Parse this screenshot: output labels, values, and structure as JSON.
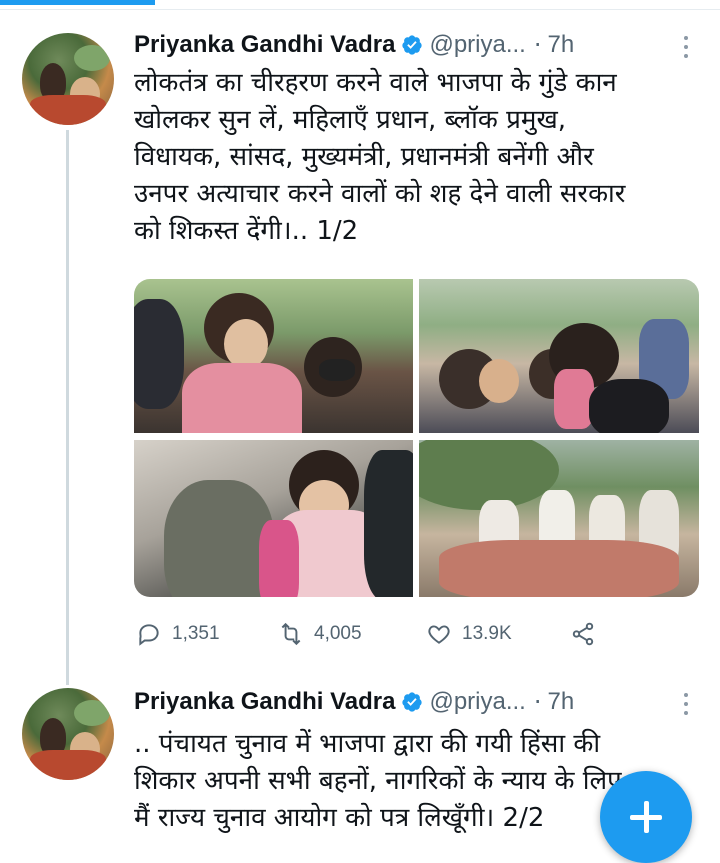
{
  "colors": {
    "accent": "#1d9bf0",
    "text": "#0f1419",
    "muted": "#536471"
  },
  "tweets": [
    {
      "author_name": "Priyanka Gandhi Vadra",
      "handle": "@priya...",
      "separator": "·",
      "time": "7h",
      "text": "लोकतंत्र का चीरहरण करने वाले भाजपा के गुंडे कान\nखोलकर सुन लें, महिलाएँ प्रधान, ब्लॉक प्रमुख,\nविधायक, सांसद, मुख्यमंत्री, प्रधानमंत्री बनेंगी और\nउनपर अत्याचार करने वालों को शह देने वाली सरकार\nको शिकस्त देंगी।.. 1/2",
      "actions": {
        "replies": "1,351",
        "retweets": "4,005",
        "likes": "13.9K"
      }
    },
    {
      "author_name": "Priyanka Gandhi Vadra",
      "handle": "@priya...",
      "separator": "·",
      "time": "7h",
      "text": ".. पंचायत चुनाव में भाजपा द्वारा की गयी हिंसा की\nशिकार अपनी सभी बहनों, नागरिकों के न्याय के लिए\nमैं राज्य चुनाव आयोग को पत्र लिखूँगी। 2/2"
    }
  ],
  "icons": {
    "verified": "verified-badge-icon",
    "menu": "more-options-icon",
    "reply": "reply-icon",
    "retweet": "retweet-icon",
    "like": "heart-icon",
    "share": "share-icon",
    "compose": "plus-icon"
  }
}
